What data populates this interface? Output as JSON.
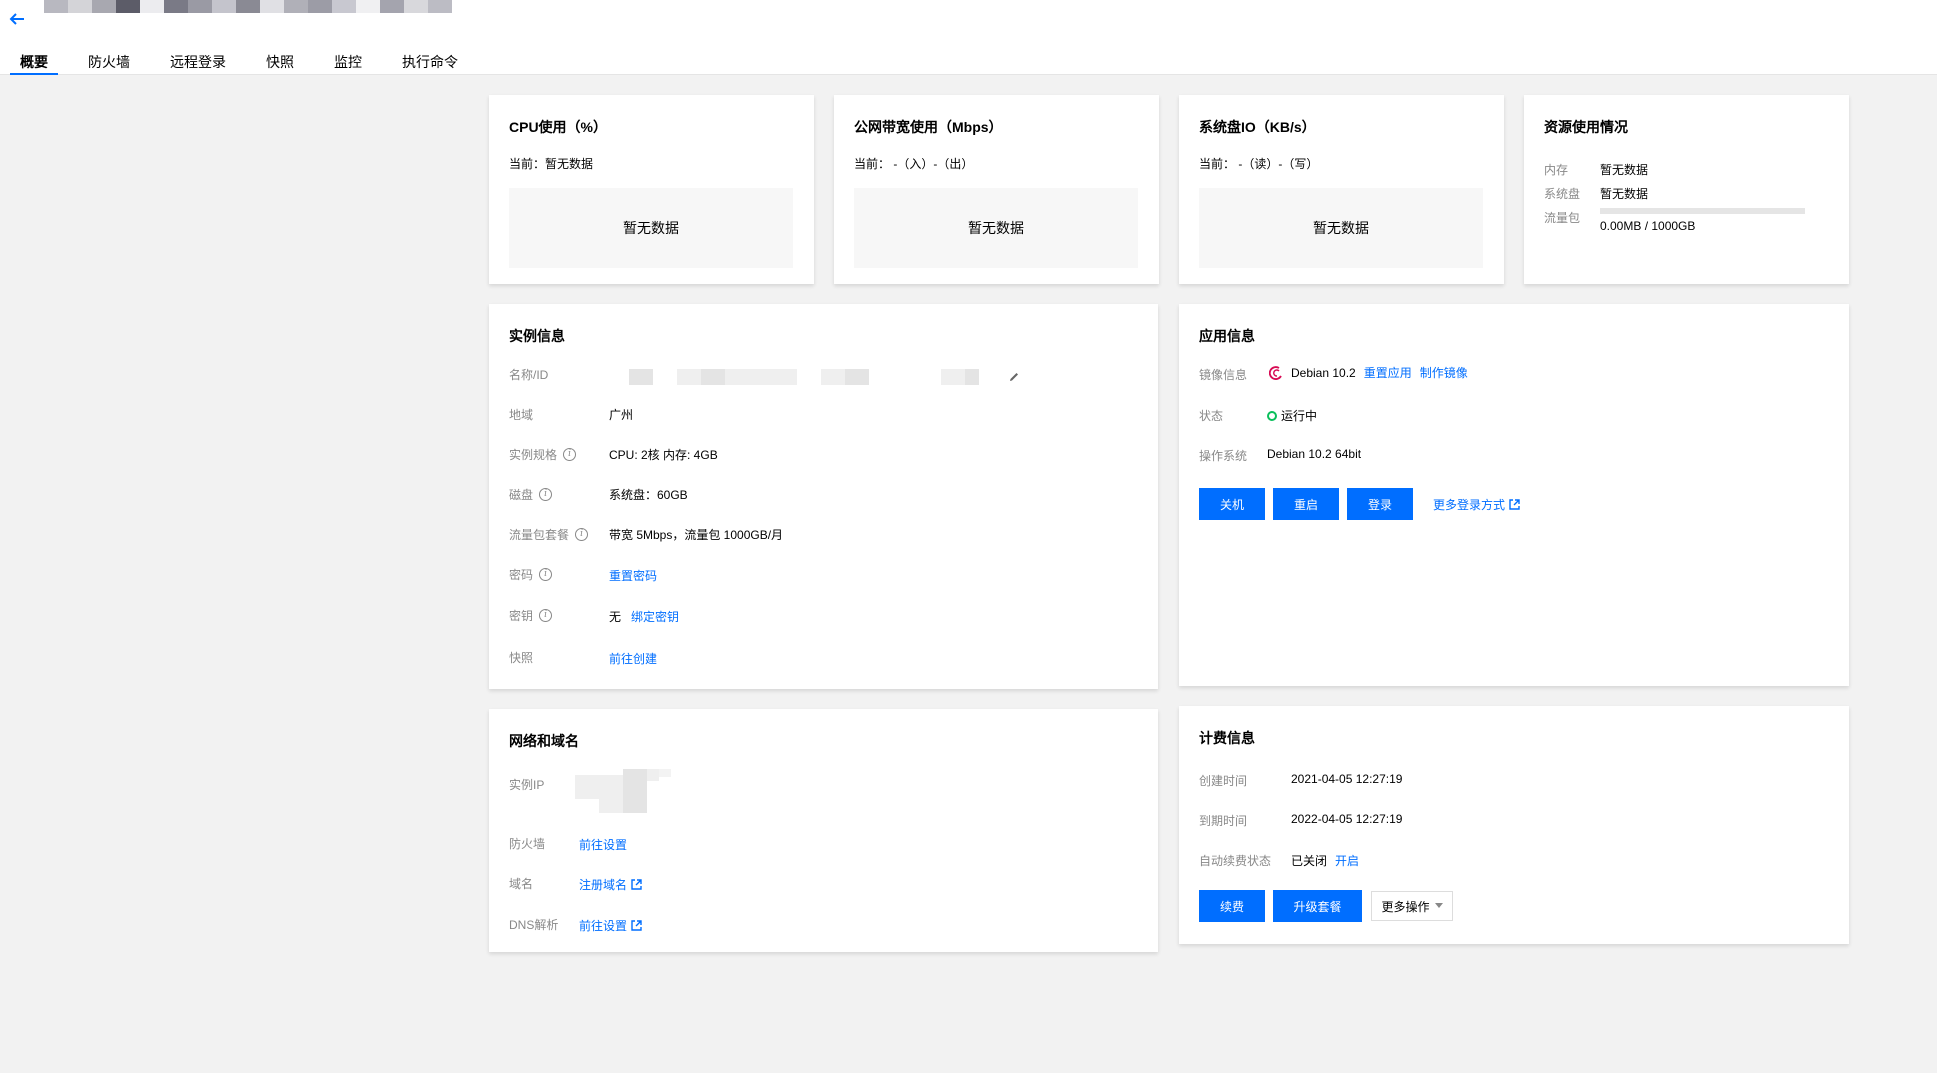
{
  "tabs": [
    {
      "label": "概要",
      "active": true
    },
    {
      "label": "防火墙"
    },
    {
      "label": "远程登录"
    },
    {
      "label": "快照"
    },
    {
      "label": "监控"
    },
    {
      "label": "执行命令"
    }
  ],
  "metrics": {
    "cpu": {
      "title": "CPU使用（%）",
      "current": "当前：暂无数据",
      "empty": "暂无数据"
    },
    "bandwidth": {
      "title": "公网带宽使用（Mbps）",
      "current": "当前： -（入）-（出）",
      "empty": "暂无数据"
    },
    "diskio": {
      "title": "系统盘IO（KB/s）",
      "current": "当前： -（读）-（写）",
      "empty": "暂无数据"
    },
    "resource": {
      "title": "资源使用情况",
      "memory_label": "内存",
      "memory_value": "暂无数据",
      "disk_label": "系统盘",
      "disk_value": "暂无数据",
      "traffic_label": "流量包",
      "traffic_value": "0.00MB / 1000GB",
      "traffic_fraction": 0.0
    }
  },
  "instance": {
    "title": "实例信息",
    "name_label": "名称/ID",
    "region_label": "地域",
    "region_value": "广州",
    "spec_label": "实例规格",
    "spec_value": "CPU: 2核 内存: 4GB",
    "disk_label": "磁盘",
    "disk_value": "系统盘：60GB",
    "traffic_label": "流量包套餐",
    "traffic_value": "带宽 5Mbps，流量包 1000GB/月",
    "password_label": "密码",
    "password_link": "重置密码",
    "key_label": "密钥",
    "key_value": "无",
    "key_link": "绑定密钥",
    "snapshot_label": "快照",
    "snapshot_link": "前往创建"
  },
  "app": {
    "title": "应用信息",
    "image_label": "镜像信息",
    "image_value": "Debian 10.2",
    "reset_link": "重置应用",
    "make_image_link": "制作镜像",
    "status_label": "状态",
    "status_value": "运行中",
    "os_label": "操作系统",
    "os_value": "Debian 10.2 64bit",
    "btn_shutdown": "关机",
    "btn_restart": "重启",
    "btn_login": "登录",
    "more_login": "更多登录方式"
  },
  "network": {
    "title": "网络和域名",
    "ip_label": "实例IP",
    "firewall_label": "防火墙",
    "firewall_link": "前往设置",
    "domain_label": "域名",
    "domain_link": "注册域名",
    "dns_label": "DNS解析",
    "dns_link": "前往设置"
  },
  "billing": {
    "title": "计费信息",
    "created_label": "创建时间",
    "created_value": "2021-04-05 12:27:19",
    "expire_label": "到期时间",
    "expire_value": "2022-04-05 12:27:19",
    "autorenew_label": "自动续费状态",
    "autorenew_value": "已关闭",
    "autorenew_link": "开启",
    "btn_renew": "续费",
    "btn_upgrade": "升级套餐",
    "btn_more": "更多操作"
  },
  "colors": {
    "accent": "#006eff",
    "status_running": "#0abf5b",
    "debian": "#d70a53"
  }
}
